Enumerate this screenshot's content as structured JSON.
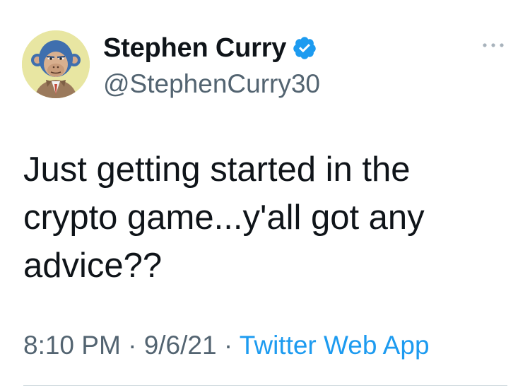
{
  "tweet": {
    "author": {
      "display_name": "Stephen Curry",
      "handle": "@StephenCurry30",
      "verified": true,
      "avatar_icon": "bored-ape-avatar"
    },
    "text": "Just getting started in the crypto game...y'all got any advice??",
    "timestamp_time": "8:10 PM",
    "separator": "·",
    "timestamp_date": "9/6/21",
    "source_app": "Twitter Web App",
    "more_icon": "more-horizontal-icon"
  },
  "colors": {
    "text": "#0f1419",
    "secondary": "#536471",
    "link": "#1d9bf0",
    "verified": "#1d9bf0",
    "divider": "#cfd9de"
  }
}
